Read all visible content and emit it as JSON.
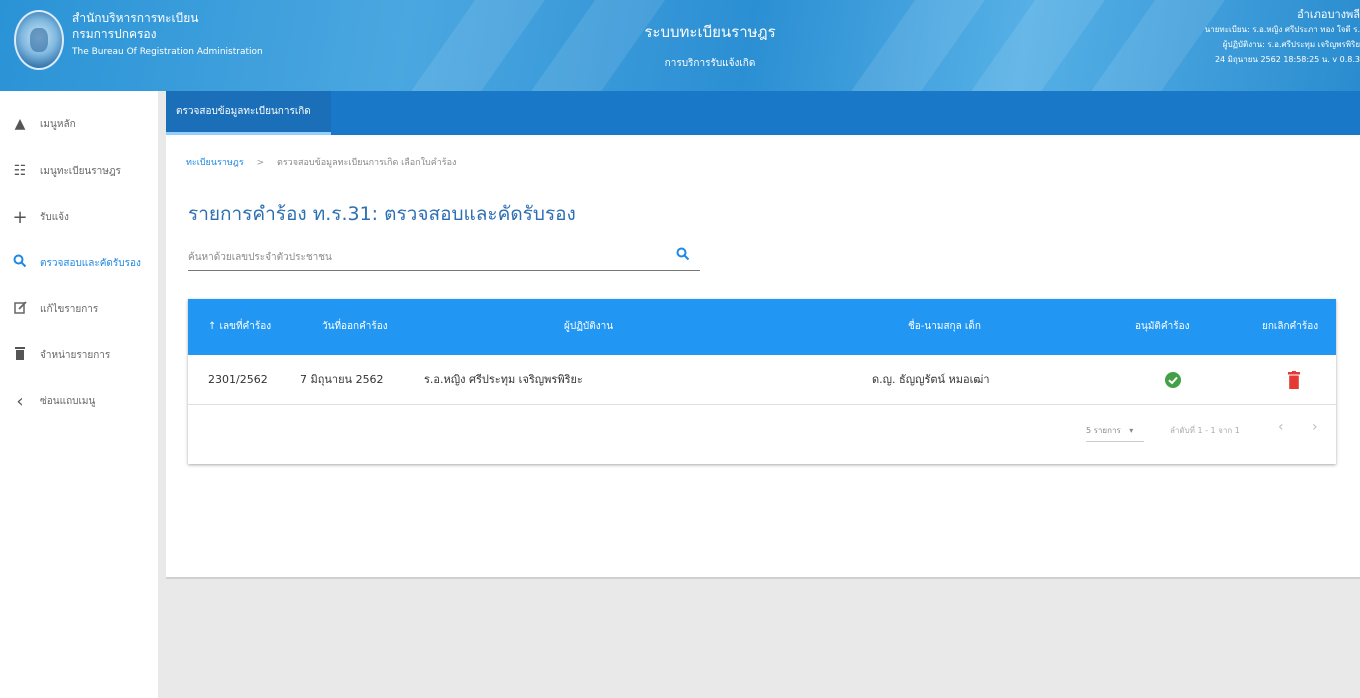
{
  "header": {
    "org_line1": "สำนักบริหารการทะเบียน",
    "org_line2": "กรมการปกครอง",
    "org_line3": "The Bureau Of Registration Administration",
    "system_title": "ระบบทะเบียนราษฎร",
    "system_subtitle": "การบริการรับแจ้งเกิด",
    "right_line1": "อำเภอบางพลี",
    "right_line2": "นายทะเบียน: ร.อ.หญิง ศรีประภา ทอง ใจดี ร.",
    "right_line3": "ผู้ปฏิบัติงาน: ร.อ.ศรีประทุม เจริญพรพิริย",
    "right_line4": "24 มิถุนายน 2562 18:58:25 น.   v 0.8.3"
  },
  "sidebar": {
    "items": [
      {
        "icon": "home-icon",
        "glyph": "🏠",
        "label": "เมนูหลัก"
      },
      {
        "icon": "grid-icon",
        "glyph": "☷",
        "label": "เมนูทะเบียนราษฎร"
      },
      {
        "icon": "plus-icon",
        "glyph": "+",
        "label": "รับแจ้ง"
      },
      {
        "icon": "search-icon",
        "glyph": "⌕",
        "label": "ตรวจสอบและคัดรับรอง"
      },
      {
        "icon": "edit-icon",
        "glyph": "✎",
        "label": "แก้ไขรายการ"
      },
      {
        "icon": "trash-icon",
        "glyph": "🗑",
        "label": "จำหน่ายรายการ"
      },
      {
        "icon": "chevron-left-icon",
        "glyph": "‹",
        "label": "ซ่อนแถบเมนู"
      }
    ],
    "active_index": 3
  },
  "tabs": {
    "active_label": "ตรวจสอบข้อมูลทะเบียนการเกิด"
  },
  "breadcrumb": {
    "root": "ทะเบียนราษฎร",
    "separator": ">",
    "current": "ตรวจสอบข้อมูลทะเบียนการเกิด เลือกใบคำร้อง"
  },
  "page": {
    "title": "รายการคำร้อง ท.ร.31: ตรวจสอบและคัดรับรอง"
  },
  "search": {
    "placeholder": "ค้นหาด้วยเลขประจำตัวประชาชน"
  },
  "table": {
    "headers": {
      "request_no": "↑ เลขที่คำร้อง",
      "date": "วันที่ออกคำร้อง",
      "officer": "ผู้ปฏิบัติงาน",
      "child_name": "ชื่อ-นามสกุล เด็ก",
      "approve": "อนุมัติคำร้อง",
      "cancel": "ยกเลิกคำร้อง"
    },
    "rows": [
      {
        "request_no": "2301/2562",
        "date": "7 มิถุนายน 2562",
        "officer": "ร.อ.หญิง ศรีประทุม เจริญพรพิริยะ",
        "child_name": "ด.ญ. ธัญญรัตน์ หมอเฒ่า"
      }
    ],
    "per_page": "5 รายการ",
    "range": "ลำดับที่ 1 - 1 จาก 1"
  },
  "colors": {
    "header_blue": "#2a93d6",
    "table_header": "#2196f3",
    "approve_green": "#43a047",
    "delete_red": "#e53935"
  }
}
